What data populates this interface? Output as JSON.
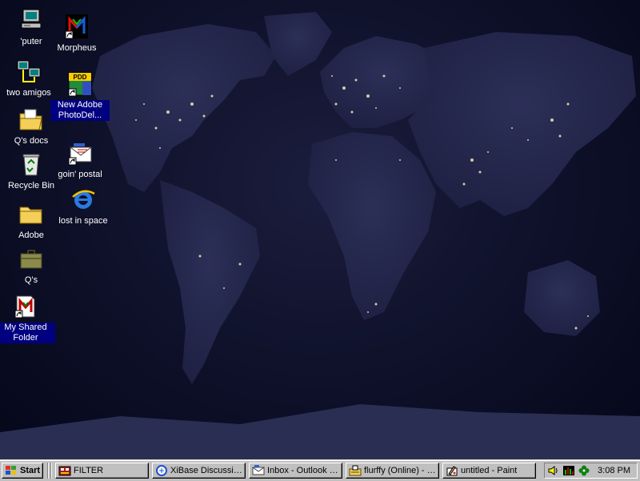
{
  "desktop": {
    "icons": [
      {
        "label": "'puter",
        "icon": "my-computer-icon"
      },
      {
        "label": "two amigos",
        "icon": "network-neighborhood-icon"
      },
      {
        "label": "Q's docs",
        "icon": "folder-documents-icon"
      },
      {
        "label": "Recycle Bin",
        "icon": "recycle-bin-icon"
      },
      {
        "label": "Adobe",
        "icon": "folder-icon"
      },
      {
        "label": "Q's",
        "icon": "briefcase-icon"
      },
      {
        "label": "My Shared Folder",
        "icon": "shared-folder-shortcut-icon"
      },
      {
        "label": "Morpheus",
        "icon": "morpheus-shortcut-icon"
      },
      {
        "label": "New Adobe PhotoDel...",
        "icon": "pdd-shortcut-icon"
      },
      {
        "label": "goin' postal",
        "icon": "outlook-express-shortcut-icon"
      },
      {
        "label": "lost in space",
        "icon": "internet-explorer-icon"
      }
    ],
    "wallpaper": "world-at-night"
  },
  "taskbar": {
    "start_label": "Start",
    "tasks": [
      {
        "label": "FILTER",
        "icon": "filter-app-icon"
      },
      {
        "label": "XiBase Discussio...",
        "icon": "xibase-icon"
      },
      {
        "label": "Inbox - Outlook E...",
        "icon": "outlook-inbox-icon"
      },
      {
        "label": "flurffy (Online) - M...",
        "icon": "messenger-icon"
      },
      {
        "label": "untitled - Paint",
        "icon": "paint-icon"
      }
    ],
    "tray": {
      "icons": [
        "volume-icon",
        "network-activity-icon",
        "clover-icon"
      ],
      "clock": "3:08 PM"
    }
  },
  "colors": {
    "desktop": "#0d1028",
    "taskbar": "#c0c0c0",
    "selection": "#000080",
    "city_lights": "#f3e9b0"
  }
}
